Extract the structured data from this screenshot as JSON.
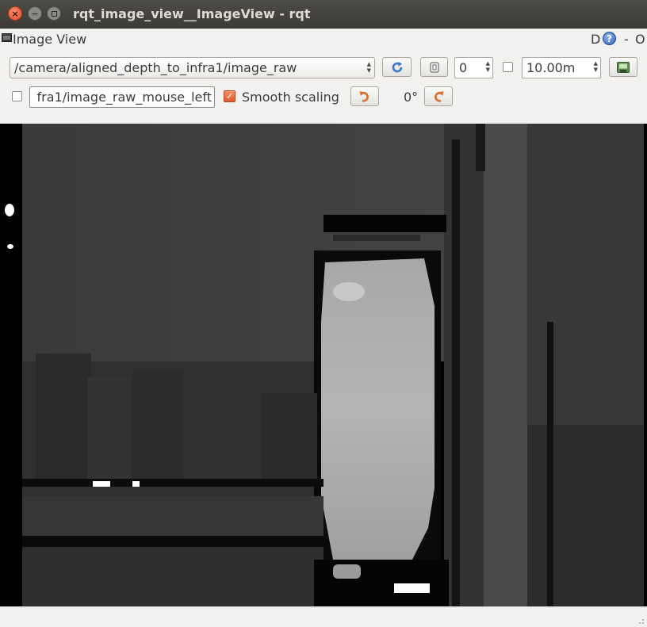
{
  "window": {
    "title": "rqt_image_view__ImageView - rqt",
    "close_glyph": "×",
    "minimize_glyph": "−"
  },
  "dock": {
    "title": "Image View",
    "right_letter": "D",
    "help_glyph": "?",
    "dash": "-",
    "right_o": "O"
  },
  "toolbar": {
    "topic": "/camera/aligned_depth_to_infra1/image_raw",
    "refresh_icon": "refresh-icon",
    "zoom_value": "0",
    "dynamic_range_checked": false,
    "max_depth": "10.00m",
    "save_icon": "save-image-icon"
  },
  "toolbar2": {
    "mouse_publish_checked": false,
    "mouse_topic": "fra1/image_raw_mouse_left",
    "smooth_scaling_checked": true,
    "smooth_scaling_label": "Smooth scaling",
    "rotation_label": "0°",
    "rotate_left_icon": "rotate-ccw-icon",
    "rotate_right_icon": "rotate-cw-icon"
  },
  "image": {
    "description_icon": "depth-image"
  }
}
